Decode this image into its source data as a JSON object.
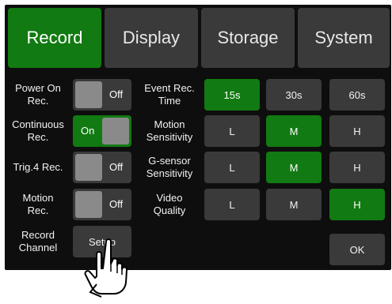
{
  "tabs": [
    {
      "label": "Record",
      "active": true
    },
    {
      "label": "Display",
      "active": false
    },
    {
      "label": "Storage",
      "active": false
    },
    {
      "label": "System",
      "active": false
    }
  ],
  "left": {
    "power_on": {
      "label": "Power On\nRec.",
      "value": "Off"
    },
    "continuous": {
      "label": "Continuous\nRec.",
      "value": "On"
    },
    "trig4": {
      "label": "Trig.4 Rec.",
      "value": "Off"
    },
    "motion": {
      "label": "Motion\nRec.",
      "value": "Off"
    },
    "record_channel": {
      "label": "Record\nChannel",
      "button": "Setup"
    }
  },
  "right": {
    "event_time": {
      "label": "Event Rec.\nTime",
      "options": [
        "15s",
        "30s",
        "60s"
      ],
      "selected": "15s"
    },
    "motion_sens": {
      "label": "Motion\nSensitivity",
      "options": [
        "L",
        "M",
        "H"
      ],
      "selected": "M"
    },
    "gsensor_sens": {
      "label": "G-sensor\nSensitivity",
      "options": [
        "L",
        "M",
        "H"
      ],
      "selected": "M"
    },
    "video_quality": {
      "label": "Video\nQuality",
      "options": [
        "L",
        "M",
        "H"
      ],
      "selected": "H"
    }
  },
  "ok_label": "OK",
  "colors": {
    "accent": "#127a12",
    "button": "#3a3a3a",
    "background": "#0e0e0e"
  }
}
